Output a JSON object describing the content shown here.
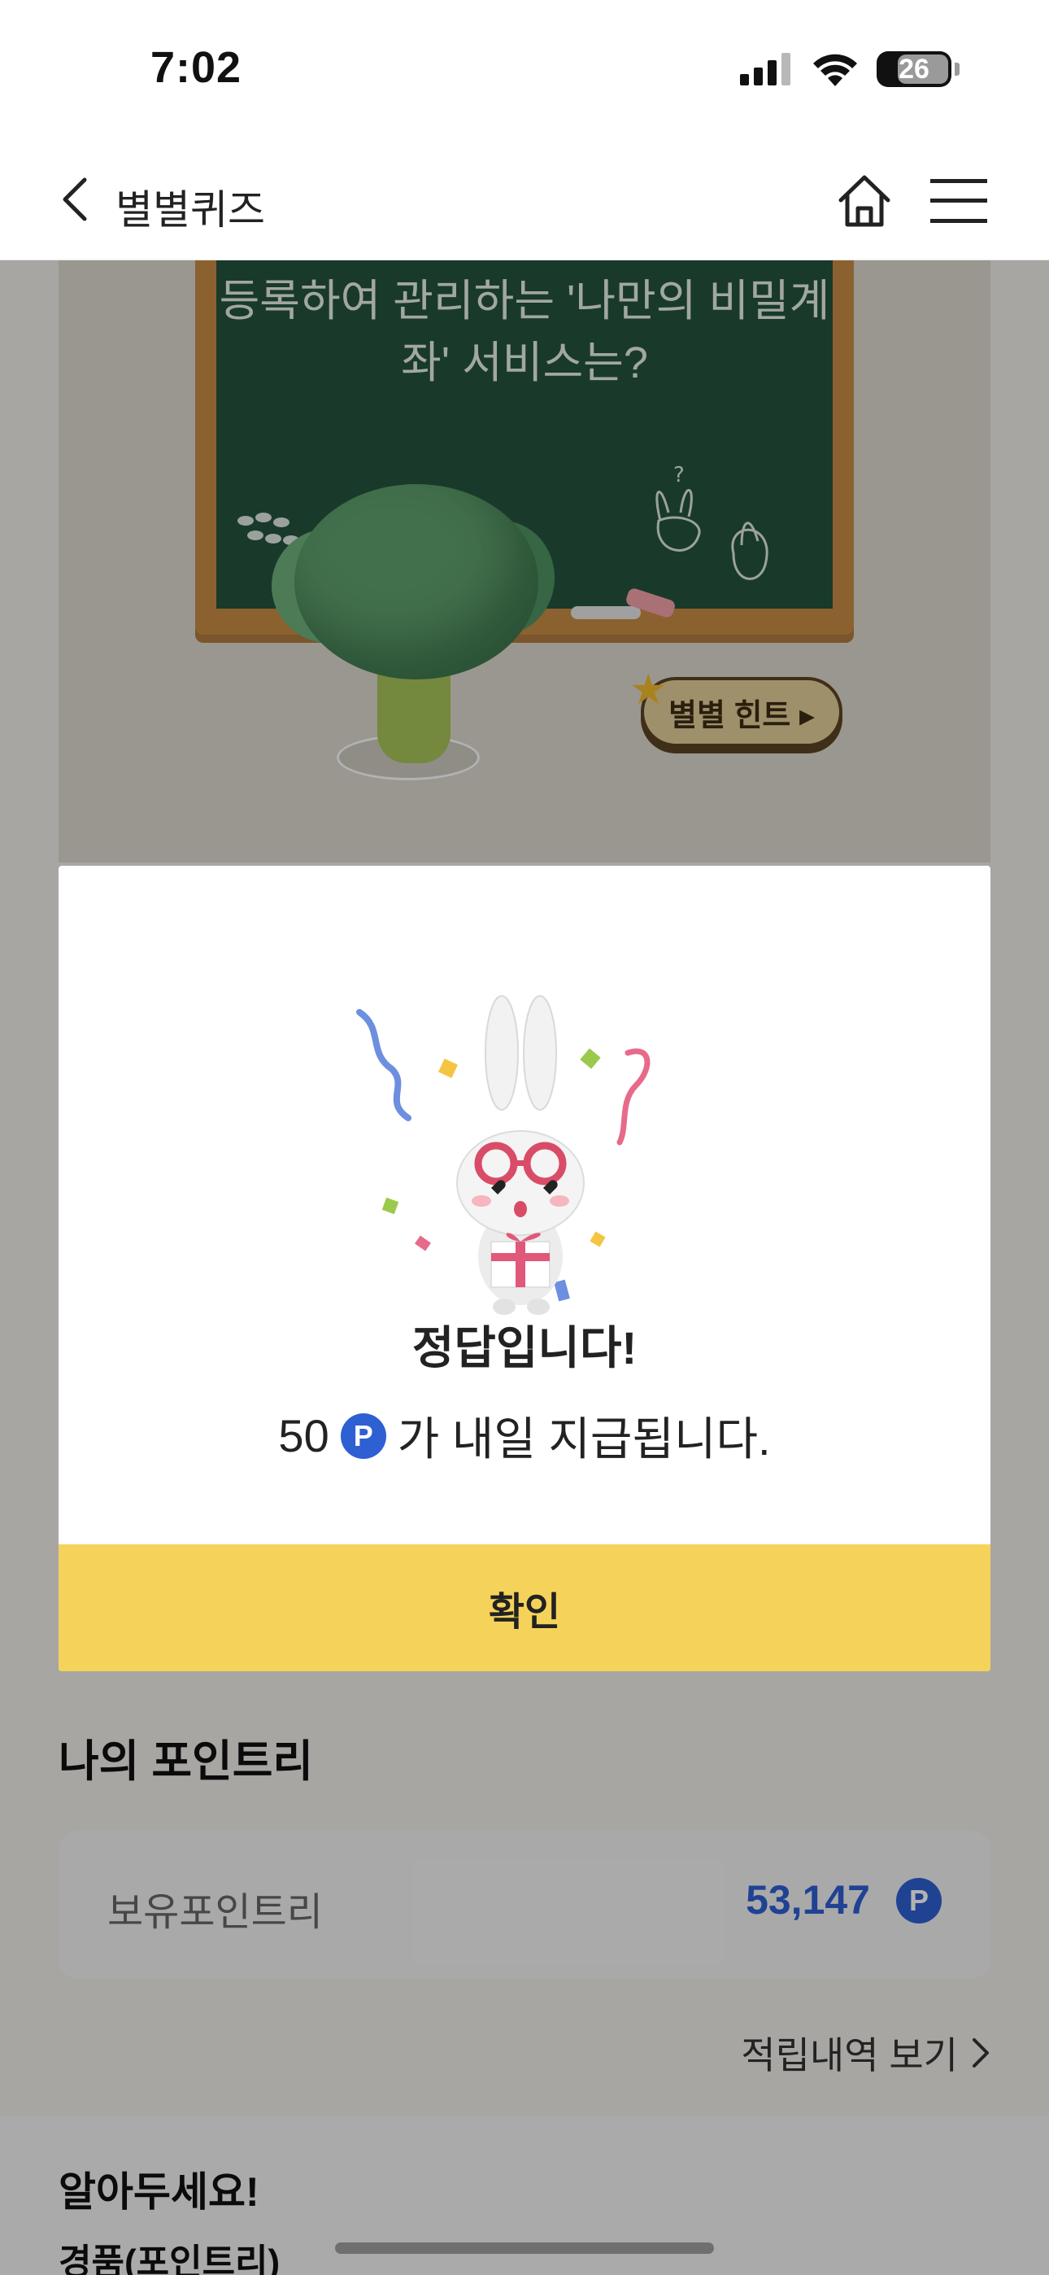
{
  "status_bar": {
    "time": "7:02",
    "battery": "26",
    "icons": [
      "cellular-signal-icon",
      "wifi-icon",
      "battery-icon"
    ]
  },
  "nav": {
    "title": "별별퀴즈",
    "icons": [
      "back-chevron-icon",
      "home-icon",
      "hamburger-menu-icon"
    ]
  },
  "quiz": {
    "question": "등록하여 관리하는 '나만의 비밀계좌' 서비스는?",
    "hint_button": "별별 힌트 ▸"
  },
  "modal": {
    "title": "정답입니다!",
    "amount": "50",
    "badge": "P",
    "message": "가 내일 지급됩니다.",
    "confirm_label": "확인"
  },
  "points": {
    "section_title": "나의 포인트리",
    "label": "보유포인트리",
    "value": "53,147",
    "badge": "P",
    "history_link": "적립내역 보기"
  },
  "notice": {
    "title": "알아두세요!",
    "subtitle": "경품(포인트리)"
  },
  "colors": {
    "accent_yellow": "#F5D35B",
    "point_blue": "#2E5FD3",
    "chalkboard": "#24543E"
  }
}
